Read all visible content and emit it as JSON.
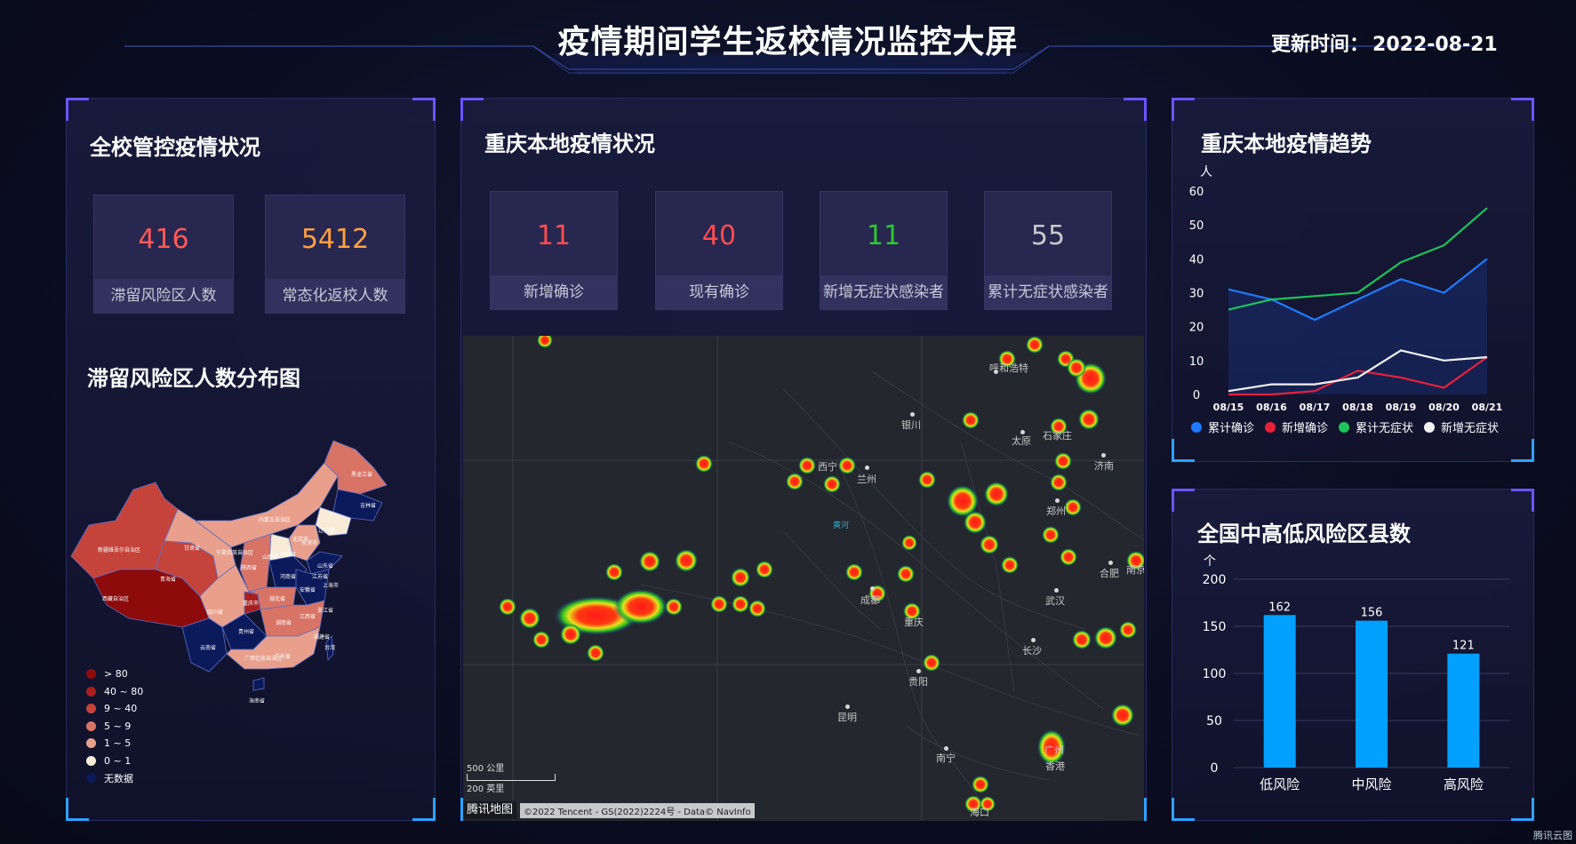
{
  "header": {
    "title": "疫情期间学生返校情况监控大屏",
    "update_label": "更新时间：",
    "update_value": "2022-08-21"
  },
  "school_panel": {
    "title": "全校管控疫情状况",
    "stats": [
      {
        "value": "416",
        "label": "滞留风险区人数",
        "color": "#ff5a55"
      },
      {
        "value": "5412",
        "label": "常态化返校人数",
        "color": "#ffa040"
      }
    ],
    "map_title": "滞留风险区人数分布图",
    "legend": [
      {
        "label": "> 80",
        "color": "#8e0b0b"
      },
      {
        "label": "40 ~ 80",
        "color": "#a8201e"
      },
      {
        "label": "9 ~ 40",
        "color": "#c4443c"
      },
      {
        "label": "5 ~ 9",
        "color": "#d87466"
      },
      {
        "label": "1 ~ 5",
        "color": "#e8a08c"
      },
      {
        "label": "0 ~ 1",
        "color": "#f8ecd8"
      },
      {
        "label": "无数据",
        "color": "#0b1a5a"
      }
    ],
    "province_labels": [
      "新疆维吾尔自治区",
      "西藏自治区",
      "青海省",
      "甘肃省",
      "内蒙古自治区",
      "黑龙江省",
      "吉林省",
      "辽宁省",
      "北京市",
      "天津市",
      "河北省",
      "山东省",
      "山西省",
      "陕西省",
      "宁夏回族自治区",
      "河南省",
      "四川省",
      "湖北省",
      "安徽省",
      "江苏省",
      "上海市",
      "重庆市",
      "湖南省",
      "江西省",
      "浙江省",
      "贵州省",
      "云南省",
      "福建省",
      "广西壮族自治区",
      "广东省",
      "台湾",
      "海南省"
    ]
  },
  "chongqing_panel": {
    "title": "重庆本地疫情状况",
    "stats": [
      {
        "value": "11",
        "label": "新增确诊",
        "color": "#ff4d4d"
      },
      {
        "value": "40",
        "label": "现有确诊",
        "color": "#ff4d4d"
      },
      {
        "value": "11",
        "label": "新增无症状感染者",
        "color": "#2ec72e"
      },
      {
        "value": "55",
        "label": "累计无症状感染者",
        "color": "#c8c8c8"
      }
    ],
    "map": {
      "cities": [
        "呼和浩特",
        "银川",
        "太原",
        "石家庄",
        "济南",
        "西宁",
        "兰州",
        "郑州",
        "合肥",
        "南京",
        "成都",
        "武汉",
        "重庆",
        "长沙",
        "贵阳",
        "昆明",
        "南宁",
        "广州",
        "香港",
        "黄河",
        "海口"
      ],
      "scale_top": "500 公里",
      "scale_bottom": "200 英里",
      "logo": "腾讯地图",
      "copyright": "©2022 Tencent - GS(2022)2224号 - Data© NavInfo"
    }
  },
  "trend_panel": {
    "title": "重庆本地疫情趋势",
    "unit": "人",
    "chart_data": {
      "type": "line",
      "x": [
        "08/15",
        "08/16",
        "08/17",
        "08/18",
        "08/19",
        "08/20",
        "08/21"
      ],
      "ylim": [
        0,
        60
      ],
      "yticks": [
        0,
        10,
        20,
        30,
        40,
        50,
        60
      ],
      "series": [
        {
          "name": "累计确诊",
          "color": "#1e7bff",
          "values": [
            31,
            28,
            22,
            28,
            34,
            30,
            40
          ]
        },
        {
          "name": "新增确诊",
          "color": "#e8203a",
          "values": [
            0,
            0,
            1,
            7,
            5,
            2,
            11
          ]
        },
        {
          "name": "累计无症状",
          "color": "#1ec45a",
          "values": [
            25,
            28,
            29,
            30,
            39,
            44,
            55
          ]
        },
        {
          "name": "新增无症状",
          "color": "#f2f2f2",
          "values": [
            1,
            3,
            3,
            5,
            13,
            10,
            11
          ]
        }
      ]
    }
  },
  "risk_panel": {
    "title": "全国中高低风险区县数",
    "unit": "个",
    "chart_data": {
      "type": "bar",
      "categories": [
        "低风险",
        "中风险",
        "高风险"
      ],
      "values": [
        162,
        156,
        121
      ],
      "ylim": [
        0,
        200
      ],
      "yticks": [
        0,
        50,
        100,
        150,
        200
      ],
      "color": "#00a0ff"
    }
  },
  "brand": "腾讯云图"
}
